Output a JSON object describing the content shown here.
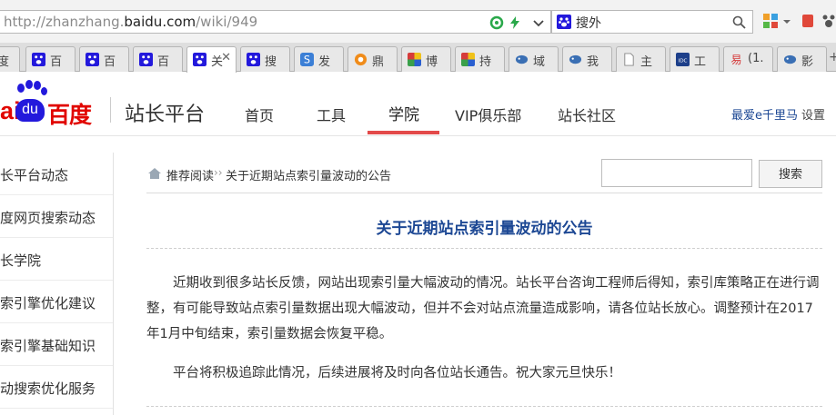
{
  "browser": {
    "url_prefix": "http://zhanzhang.",
    "url_domain": "baidu.com",
    "url_path": "/wiki/949",
    "search_engine_text": "搜外"
  },
  "tabs": [
    {
      "label": "度",
      "icon": "baidu-paw-icon",
      "color": "#2319dc"
    },
    {
      "label": "百",
      "icon": "baidu-paw-icon",
      "color": "#2319dc"
    },
    {
      "label": "百",
      "icon": "baidu-paw-icon",
      "color": "#2319dc"
    },
    {
      "label": "百",
      "icon": "baidu-paw-icon",
      "color": "#2319dc"
    },
    {
      "label": "关",
      "icon": "baidu-paw-icon",
      "color": "#2319dc",
      "active": true
    },
    {
      "label": "搜",
      "icon": "baidu-paw-icon",
      "color": "#2319dc"
    },
    {
      "label": "发",
      "icon": "s-icon",
      "color": "#3b7fd6"
    },
    {
      "label": "鼎",
      "icon": "orange-circle-icon",
      "color": "#f08c1a"
    },
    {
      "label": "博",
      "icon": "colorful-icon",
      "color": "#d63b3b"
    },
    {
      "label": "持",
      "icon": "colorful-icon",
      "color": "#d63b3b"
    },
    {
      "label": "域",
      "icon": "fish-icon",
      "color": "#3a6fb4"
    },
    {
      "label": "我",
      "icon": "fish-icon",
      "color": "#3a6fb4"
    },
    {
      "label": "主",
      "icon": "document-icon",
      "color": "#888888"
    },
    {
      "label": "工",
      "icon": "idc-icon",
      "color": "#1d3f8a"
    },
    {
      "label": "(1.",
      "icon": "easy-icon",
      "color": "#d63b3b"
    },
    {
      "label": "影",
      "icon": "fish-icon",
      "color": "#3a6fb4"
    }
  ],
  "header": {
    "logo_ai": "ai",
    "logo_du": "du",
    "logo_cn": "百度",
    "site_name": "站长平台",
    "nav": [
      "首页",
      "工具",
      "学院",
      "VIP俱乐部",
      "站长社区"
    ],
    "active_nav": "学院",
    "user": "最爱e千里马",
    "settings": "设置"
  },
  "sidebar": {
    "items": [
      "长平台动态",
      "度网页搜索动态",
      "长学院",
      "索引擎优化建议",
      "索引擎基础知识",
      "动搜索优化服务"
    ]
  },
  "breadcrumb": {
    "first": "推荐阅读",
    "second": "关于近期站点索引量波动的公告"
  },
  "search": {
    "button": "搜索",
    "value": ""
  },
  "article": {
    "title": "关于近期站点索引量波动的公告",
    "paragraphs": [
      "近期收到很多站长反馈，网站出现索引量大幅波动的情况。站长平台咨询工程师后得知，索引库策略正在进行调整，有可能导致站点索引量数据出现大幅波动，但并不会对站点流量造成影响，请各位站长放心。调整预计在2017年1月中旬结束，索引量数据会恢复平稳。",
      "平台将积极追踪此情况，后续进展将及时向各位站长通告。祝大家元旦快乐！"
    ]
  },
  "colors": {
    "link_blue": "#1d4894",
    "nav_active_underline": "#e34a4a",
    "baidu_red": "#e10601",
    "baidu_blue": "#2319dc"
  }
}
